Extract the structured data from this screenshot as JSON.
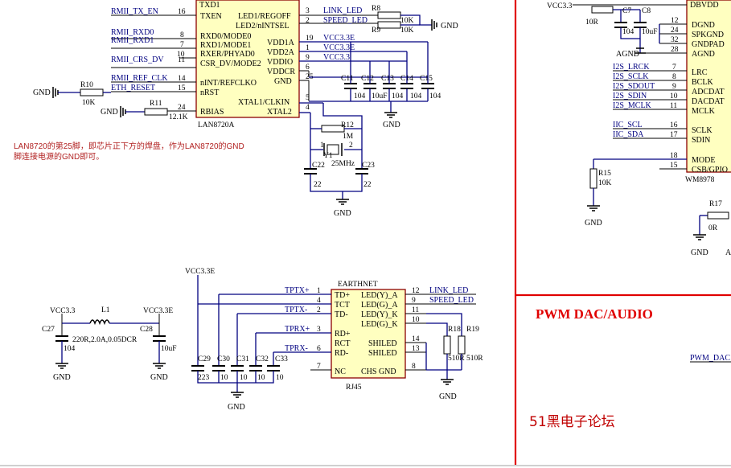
{
  "lan8720": {
    "ref": "LAN8720A",
    "pins_left": [
      {
        "num": "16",
        "name": "TXEN",
        "net": "RMII_TX_EN"
      },
      {
        "num": "8",
        "name": "RXD0/MODE0",
        "net": "RMII_RXD0"
      },
      {
        "num": "7",
        "name": "RXD1/MODE1",
        "net": "RMII_RXD1"
      },
      {
        "num": "10",
        "name": "RXER/PHYAD0",
        "net": ""
      },
      {
        "num": "11",
        "name": "CSR_DV/MODE2",
        "net": "RMII_CRS_DV"
      },
      {
        "num": "14",
        "name": "nINT/REFCLKO",
        "net": "RMII_REF_CLK"
      },
      {
        "num": "15",
        "name": "nRST",
        "net": "ETH_RESET"
      },
      {
        "num": "24",
        "name": "RBIAS",
        "net": ""
      }
    ],
    "pins_right": [
      {
        "num": "3",
        "name": "LED1/REGOFF",
        "net": "LINK_LED"
      },
      {
        "num": "2",
        "name": "LED2/nINTSEL",
        "net": "SPEED_LED"
      },
      {
        "num": "19",
        "name": "VDD1A",
        "net": "VCC3.3E"
      },
      {
        "num": "1",
        "name": "VDD2A",
        "net": "VCC3.3E"
      },
      {
        "num": "9",
        "name": "VDDIO",
        "net": "VCC3.3"
      },
      {
        "num": "6",
        "name": "VDDCR",
        "net": ""
      },
      {
        "num": "25",
        "name": "GND",
        "net": ""
      },
      {
        "num": "5",
        "name": "XTAL1/CLKIN",
        "net": ""
      },
      {
        "num": "4",
        "name": "XTAL2",
        "net": ""
      }
    ],
    "top_pin": "TXD1",
    "r8": {
      "ref": "R8",
      "val": "10K"
    },
    "r9": {
      "ref": "R9",
      "val": "10K"
    },
    "r10": {
      "ref": "R10",
      "val": "10K"
    },
    "r11": {
      "ref": "R11",
      "val": "12.1K"
    },
    "r12": {
      "ref": "R12",
      "val": "1M"
    },
    "y1": {
      "ref": "Y1",
      "val": "25MHz",
      "pin1": "1",
      "pin2": "2"
    },
    "caps": [
      {
        "ref": "C11",
        "val": "104"
      },
      {
        "ref": "C12",
        "val": "10uF"
      },
      {
        "ref": "C13",
        "val": "104"
      },
      {
        "ref": "C14",
        "val": "104"
      },
      {
        "ref": "C15",
        "val": "104"
      }
    ],
    "c22": {
      "ref": "C22",
      "val": "22"
    },
    "c23": {
      "ref": "C23",
      "val": "22"
    },
    "gnd": "GND",
    "note_line1": "LAN8720的第25脚，即芯片正下方的焊盘，作为LAN8720的GND",
    "note_line2": "脚连接电源的GND即可。"
  },
  "rj45": {
    "ref": "RJ45",
    "title": "EARTHNET",
    "vcc": "VCC3.3E",
    "pins_left": [
      {
        "num": "1",
        "name": "TD+",
        "net": "TPTX+"
      },
      {
        "num": "4",
        "name": "TCT",
        "net": ""
      },
      {
        "num": "2",
        "name": "TD-",
        "net": "TPTX-"
      },
      {
        "num": "",
        "name": "RD+",
        "net": ""
      },
      {
        "num": "3",
        "name": "RCT",
        "net": "TPRX+"
      },
      {
        "num": "6",
        "name": "RD-",
        "net": "TPRX-"
      },
      {
        "num": "7",
        "name": "NC",
        "net": ""
      }
    ],
    "pins_right": [
      {
        "num": "12",
        "name": "LED(Y)_A",
        "net": "LINK_LED"
      },
      {
        "num": "9",
        "name": "LED(G)_A",
        "net": "SPEED_LED"
      },
      {
        "num": "11",
        "name": "LED(Y)_K",
        "net": ""
      },
      {
        "num": "10",
        "name": "LED(G)_K",
        "net": ""
      },
      {
        "num": "14",
        "name": "SHILED",
        "net": ""
      },
      {
        "num": "13",
        "name": "SHILED",
        "net": ""
      },
      {
        "num": "8",
        "name": "CHS GND",
        "net": ""
      }
    ],
    "r18": {
      "ref": "R18",
      "val": "510R"
    },
    "r19": {
      "ref": "R19",
      "val": "510R"
    },
    "caps": [
      {
        "ref": "C29",
        "val": "223"
      },
      {
        "ref": "C30",
        "val": "10"
      },
      {
        "ref": "C31",
        "val": "10"
      },
      {
        "ref": "C32",
        "val": "10"
      },
      {
        "ref": "C33",
        "val": "10"
      }
    ],
    "gnd": "GND"
  },
  "filter": {
    "vcc_in": "VCC3.3",
    "vcc_out": "VCC3.3E",
    "l1": {
      "ref": "L1",
      "val": "220R,2.0A,0.05DCR"
    },
    "c27": {
      "ref": "C27",
      "val": "104"
    },
    "c28": {
      "ref": "C28",
      "val": "10uF"
    },
    "gnd": "GND"
  },
  "wm8978": {
    "ref": "WM8978",
    "top_label": "VCC3.3",
    "top_pin": "DBVDD",
    "r10r": "10R",
    "c7": {
      "ref": "C7",
      "val": "104"
    },
    "c8": {
      "ref": "C8",
      "val": "10uF"
    },
    "agnd": "AGND",
    "pins": [
      {
        "num": "12",
        "name": "DGND",
        "net": ""
      },
      {
        "num": "24",
        "name": "SPKGND",
        "net": ""
      },
      {
        "num": "32",
        "name": "GNDPAD",
        "net": ""
      },
      {
        "num": "28",
        "name": "AGND",
        "net": ""
      },
      {
        "num": "7",
        "name": "LRC",
        "net": "I2S_LRCK"
      },
      {
        "num": "8",
        "name": "BCLK",
        "net": "I2S_SCLK"
      },
      {
        "num": "9",
        "name": "ADCDAT",
        "net": "I2S_SDOUT"
      },
      {
        "num": "10",
        "name": "DACDAT",
        "net": "I2S_SDIN"
      },
      {
        "num": "11",
        "name": "MCLK",
        "net": "I2S_MCLK"
      },
      {
        "num": "16",
        "name": "SCLK",
        "net": "IIC_SCL"
      },
      {
        "num": "17",
        "name": "SDIN",
        "net": "IIC_SDA"
      },
      {
        "num": "18",
        "name": "MODE",
        "net": ""
      },
      {
        "num": "15",
        "name": "CSB/GPIO",
        "net": ""
      }
    ],
    "r15": {
      "ref": "R15",
      "val": "10K"
    },
    "r17": {
      "ref": "R17",
      "val": "0R"
    },
    "gnd": "GND",
    "agnd_cut": "A"
  },
  "pwm": {
    "title": "PWM DAC/AUDIO",
    "net": "PWM_DAC"
  },
  "forum": "51黑电子论坛"
}
